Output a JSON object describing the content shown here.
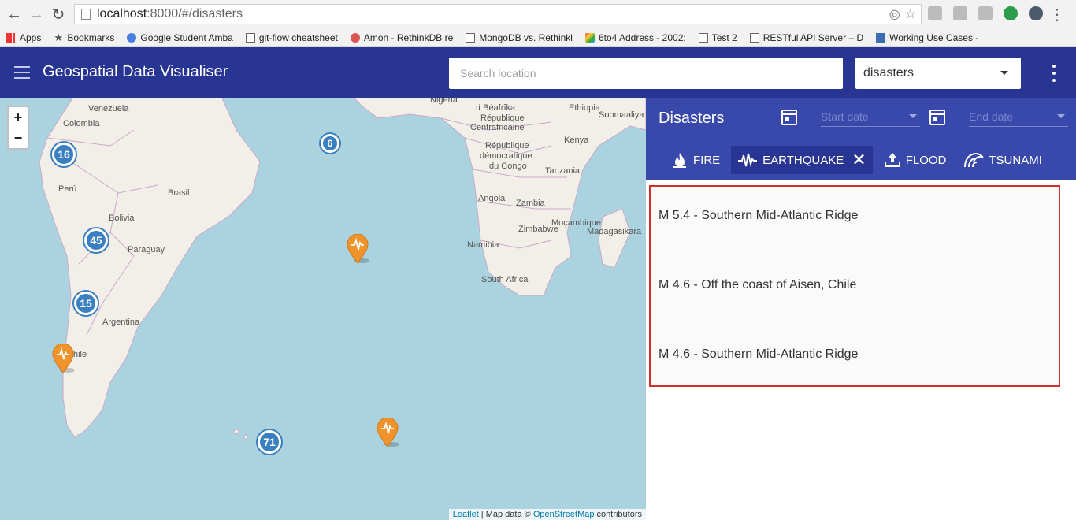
{
  "browser": {
    "url_host": "localhost",
    "url_path": ":8000/#/disasters",
    "bookmarks": [
      {
        "label": "Apps",
        "icon": "apps-icon"
      },
      {
        "label": "Bookmarks",
        "icon": "star-icon"
      },
      {
        "label": "Google Student Amba",
        "icon": "google-icon"
      },
      {
        "label": "git-flow cheatsheet",
        "icon": "doc-icon"
      },
      {
        "label": "Amon - RethinkDB re",
        "icon": "amon-icon"
      },
      {
        "label": "MongoDB vs. Rethinkl",
        "icon": "doc-icon"
      },
      {
        "label": "6to4 Address - 2002:",
        "icon": "multi-icon"
      },
      {
        "label": "Test 2",
        "icon": "doc-icon"
      },
      {
        "label": "RESTful API Server – D",
        "icon": "doc-icon"
      },
      {
        "label": "Working Use Cases -",
        "icon": "w3-icon"
      }
    ]
  },
  "header": {
    "title": "Geospatial Data Visualiser",
    "search_placeholder": "Search location",
    "dataset_selected": "disasters"
  },
  "map": {
    "zoom_in": "+",
    "zoom_out": "−",
    "labels": {
      "venezuela": "Venezuela",
      "colombia": "Colombia",
      "peru": "Perú",
      "brasil": "Brasil",
      "bolivia": "Bolivia",
      "paraguay": "Paraguay",
      "argentina": "Argentina",
      "chile": "hile",
      "nigeria": "Nigeria",
      "ethiopia": "Ethiopia",
      "car1": "tí Béafrîka",
      "car2": "République",
      "car3": "Centrafricaine",
      "soomaaliya": "Soomaaliya",
      "drc1": "République",
      "drc2": "démocratique",
      "drc3": "du Congo",
      "kenya": "Kenya",
      "tanzania": "Tanzania",
      "angola": "Angola",
      "zambia": "Zambia",
      "mozambique": "Moçambique",
      "zimbabwe": "Zimbabwe",
      "madagascar": "Madagasikara",
      "namibia": "Namibia",
      "south_africa": "South Africa"
    },
    "clusters": [
      {
        "id": "16",
        "label": "16"
      },
      {
        "id": "6",
        "label": "6"
      },
      {
        "id": "45",
        "label": "45"
      },
      {
        "id": "15",
        "label": "15"
      },
      {
        "id": "71",
        "label": "71"
      }
    ],
    "marker_color": "#f0932b",
    "attribution": {
      "leaflet": "Leaflet",
      "separator": " | Map data © ",
      "osm": "OpenStreetMap",
      "suffix": " contributors"
    }
  },
  "panel": {
    "title": "Disasters",
    "start_date_placeholder": "Start date",
    "end_date_placeholder": "End date",
    "tabs": [
      {
        "label": "FIRE",
        "icon": "fire-icon"
      },
      {
        "label": "EARTHQUAKE",
        "icon": "earthquake-icon",
        "active": true
      },
      {
        "label": "FLOOD",
        "icon": "flood-icon"
      },
      {
        "label": "TSUNAMI",
        "icon": "tsunami-icon"
      }
    ],
    "results": [
      "M 5.4 - Southern Mid-Atlantic Ridge",
      "M 4.6 - Off the coast of Aisen, Chile",
      "M 4.6 - Southern Mid-Atlantic Ridge"
    ]
  },
  "colors": {
    "appbar": "#283593",
    "panel_header": "#3949ab",
    "active_tab": "#283593",
    "highlight_border": "#d32f2f",
    "water": "#aad3df",
    "land": "#f2efe9",
    "cluster": "#3a7fc0"
  }
}
